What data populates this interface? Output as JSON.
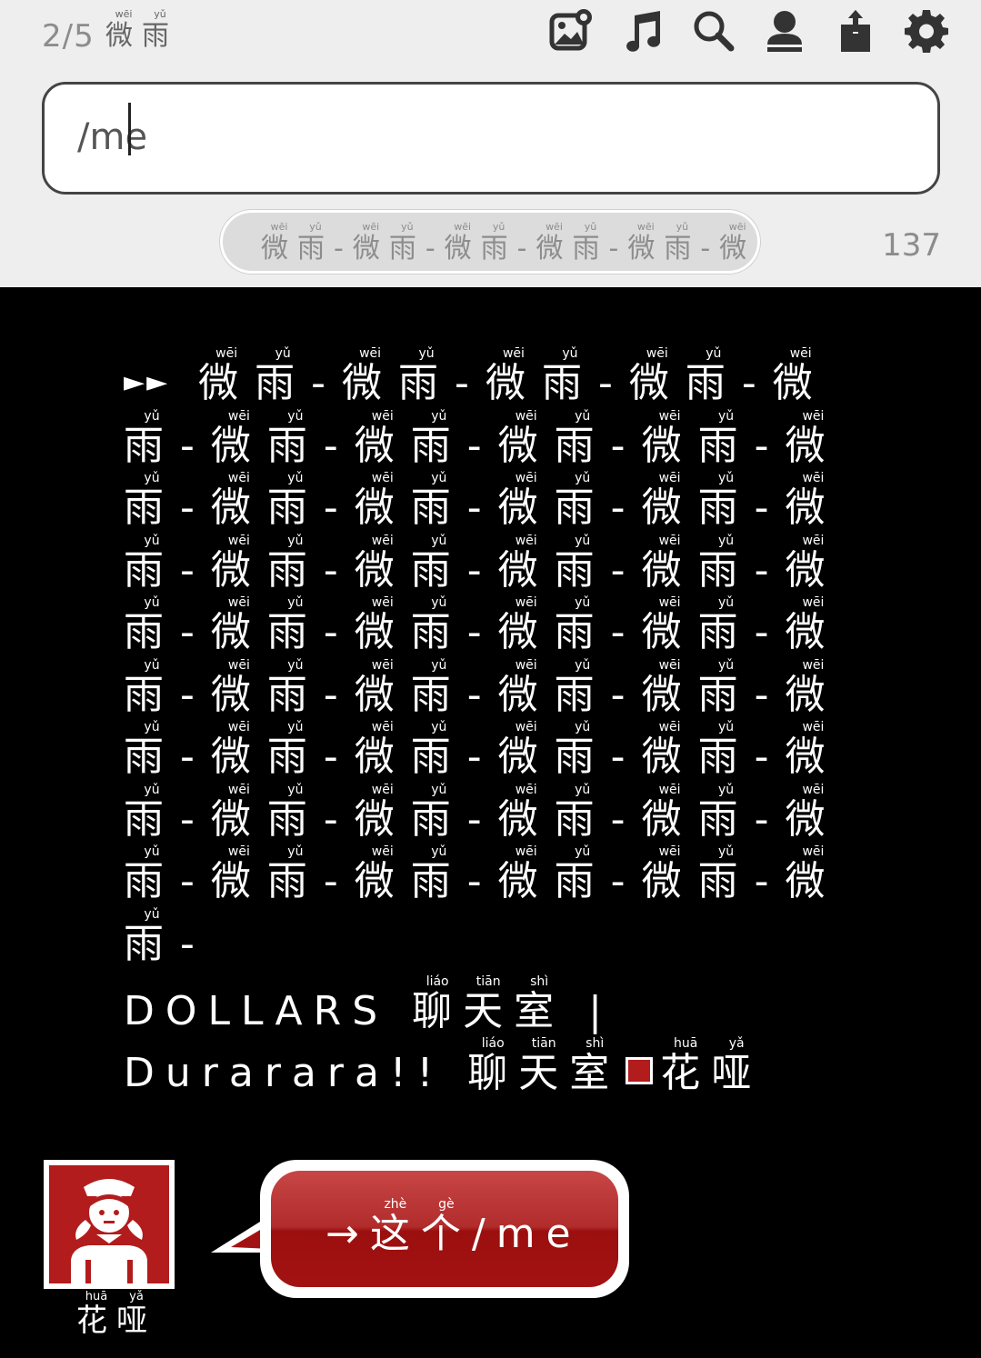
{
  "header": {
    "room_counter": "2/5",
    "room_name": [
      {
        "char": "微",
        "pinyin": "wēi"
      },
      {
        "char": "雨",
        "pinyin": "yǔ"
      }
    ],
    "toolbar": [
      {
        "name": "image-icon",
        "label": "image"
      },
      {
        "name": "music-icon",
        "label": "music"
      },
      {
        "name": "search-icon",
        "label": "search"
      },
      {
        "name": "user-icon",
        "label": "user"
      },
      {
        "name": "share-icon",
        "label": "share"
      },
      {
        "name": "gear-icon",
        "label": "settings"
      }
    ]
  },
  "composer": {
    "input_value": "/me",
    "history_preview_unit": [
      {
        "char": "微",
        "pinyin": "wēi"
      },
      {
        "char": "雨",
        "pinyin": "yǔ"
      },
      {
        "char": "-",
        "pinyin": ""
      }
    ],
    "char_count": "137"
  },
  "chat": {
    "system_message": {
      "prefix": "►►",
      "repeat_unit": [
        {
          "char": "微",
          "pinyin": "wēi"
        },
        {
          "char": "雨",
          "pinyin": "yǔ"
        },
        {
          "char": "-",
          "pinyin": ""
        }
      ],
      "repeat_count": 45
    },
    "room_banner": [
      {
        "char": "DOLLARS",
        "pinyin": ""
      },
      {
        "char": " ",
        "pinyin": ""
      },
      {
        "char": "聊",
        "pinyin": "liáo"
      },
      {
        "char": "天",
        "pinyin": "tiān"
      },
      {
        "char": "室",
        "pinyin": "shì"
      },
      {
        "char": " | ",
        "pinyin": ""
      },
      {
        "char": "Durarara!!",
        "pinyin": ""
      },
      {
        "char": " ",
        "pinyin": ""
      },
      {
        "char": "聊",
        "pinyin": "liáo"
      },
      {
        "char": "天",
        "pinyin": "tiān"
      },
      {
        "char": "室",
        "pinyin": "shì"
      }
    ],
    "room_owner": [
      {
        "char": "花",
        "pinyin": "huā"
      },
      {
        "char": "哑",
        "pinyin": "yǎ"
      }
    ],
    "user_color": "#b21c1c",
    "message": {
      "author": [
        {
          "char": "花",
          "pinyin": "huā"
        },
        {
          "char": "哑",
          "pinyin": "yǎ"
        }
      ],
      "text": [
        {
          "char": "→",
          "pinyin": ""
        },
        {
          "char": "这",
          "pinyin": "zhè"
        },
        {
          "char": "个",
          "pinyin": "gè"
        },
        {
          "char": "/me",
          "pinyin": ""
        }
      ]
    }
  }
}
